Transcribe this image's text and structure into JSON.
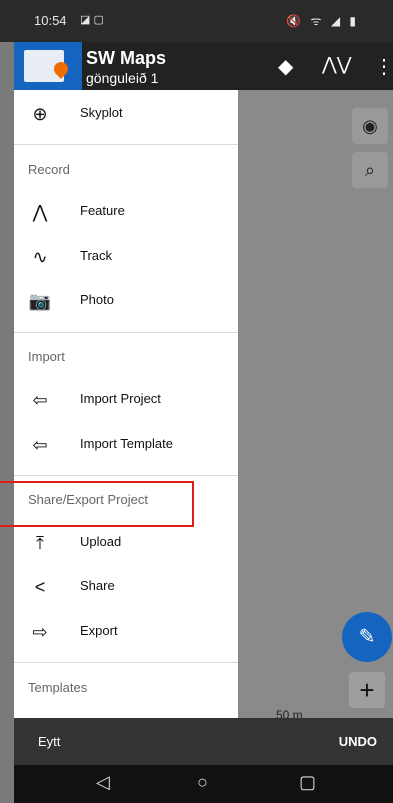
{
  "status": {
    "time": "10:54",
    "left_icons": "◪ ▢",
    "right_icons": "🔇 ᯤ ◢ ▮"
  },
  "toolbar": {
    "app_title": "SW Maps",
    "subtitle": "gönguleið 1"
  },
  "drawer": {
    "skyplot_label": "Skyplot",
    "record_header": "Record",
    "feature_label": "Feature",
    "track_label": "Track",
    "photo_label": "Photo",
    "import_header": "Import",
    "import_project_label": "Import Project",
    "import_template_label": "Import Template",
    "share_export_header": "Share/Export Project",
    "upload_label": "Upload",
    "share_label": "Share",
    "export_label": "Export",
    "templates_header": "Templates"
  },
  "map": {
    "scale_text": "50 m"
  },
  "snackbar": {
    "message": "Eytt",
    "action": "UNDO"
  },
  "icons": {
    "skyplot": "skyplot-icon",
    "feature": "feature-icon",
    "track": "track-icon",
    "photo": "add-photo-icon",
    "import": "import-icon",
    "upload": "upload-icon",
    "share": "share-icon",
    "export": "export-icon"
  },
  "colors": {
    "accent": "#1565c0",
    "highlight": "#e31b1b",
    "pin": "#ef6c00"
  }
}
